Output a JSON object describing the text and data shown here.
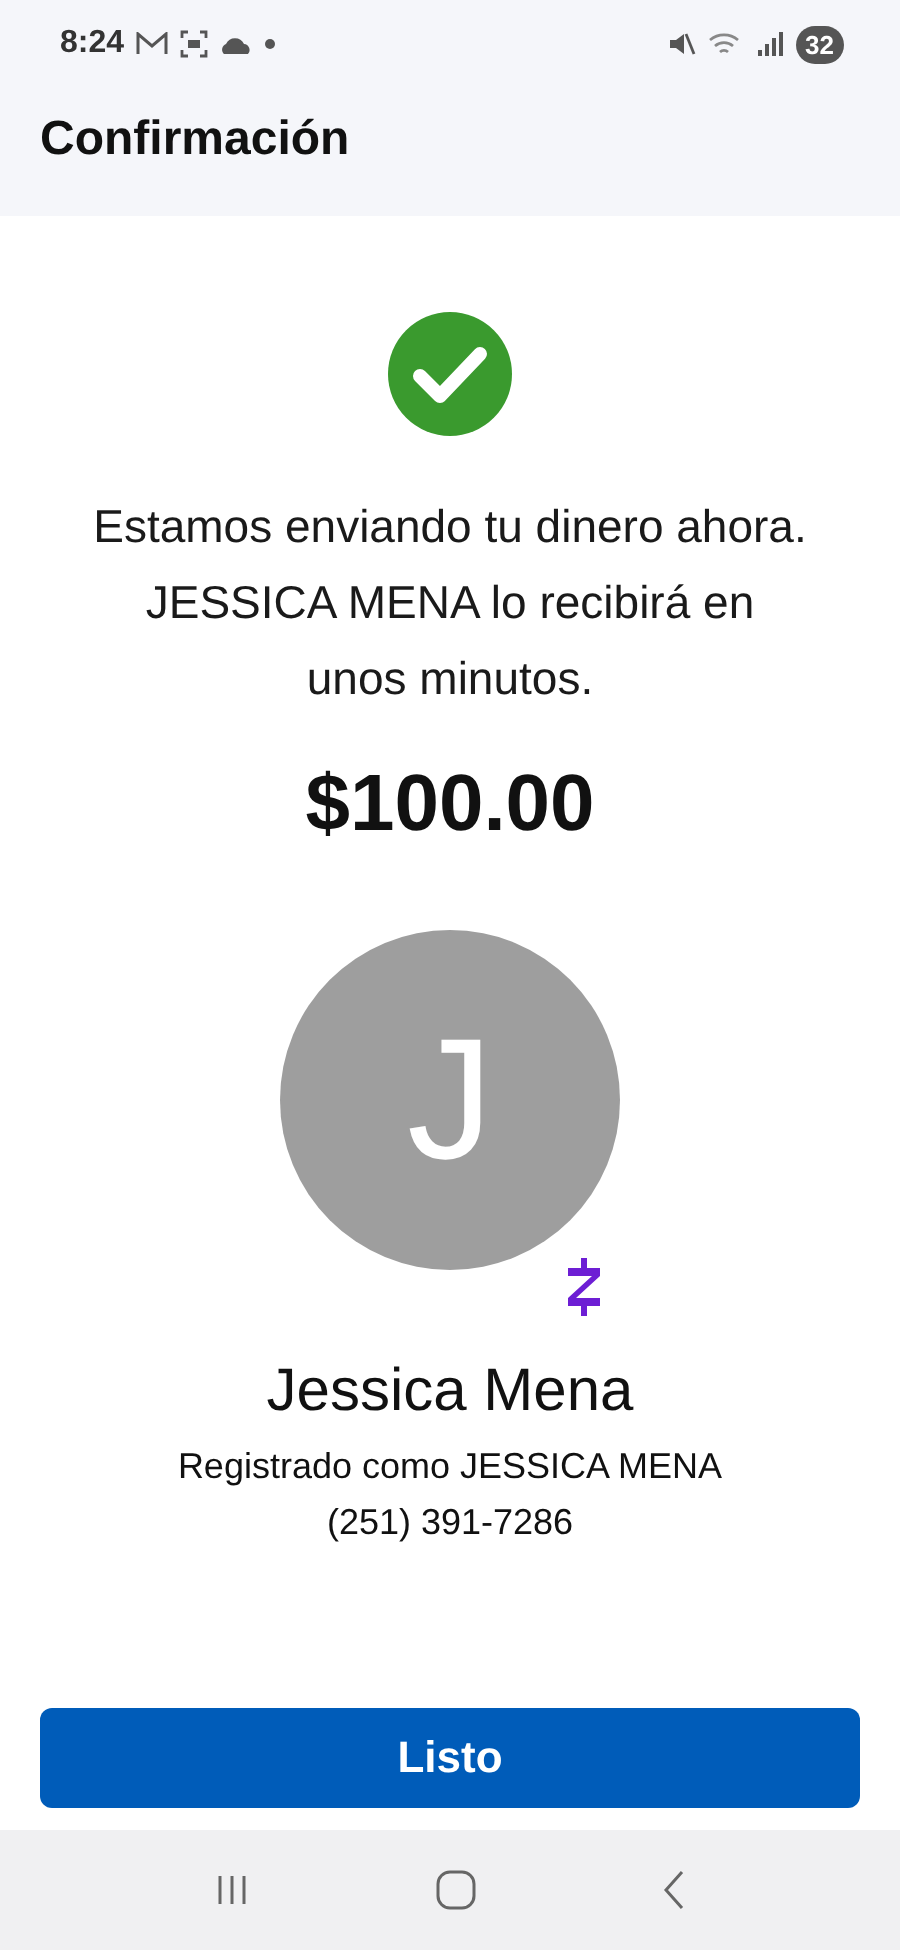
{
  "status_bar": {
    "time": "8:24",
    "battery": "32"
  },
  "header": {
    "title": "Confirmación"
  },
  "message": "Estamos enviando tu dinero ahora. JESSICA MENA lo recibirá en unos minutos.",
  "amount": "$100.00",
  "recipient": {
    "initial": "J",
    "name": "Jessica Mena",
    "registered": "Registrado como JESSICA MENA",
    "phone": "(251) 391-7286"
  },
  "primary_button": "Listo"
}
